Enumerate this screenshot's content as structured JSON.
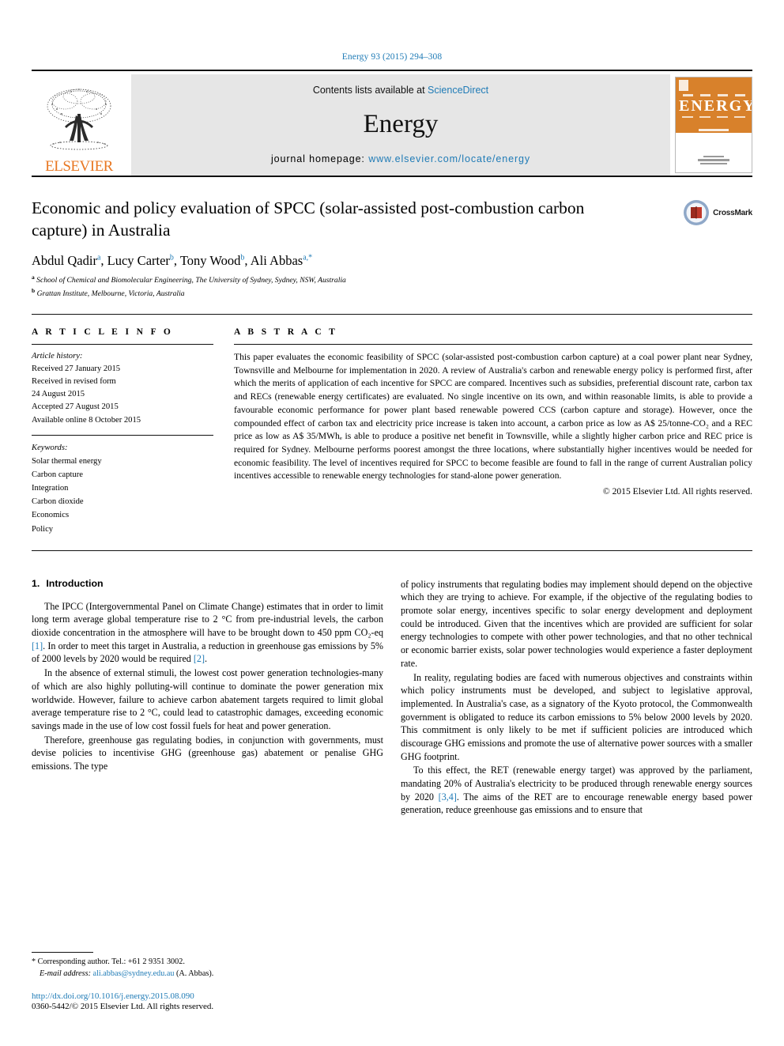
{
  "journal_ref": "Energy 93 (2015) 294–308",
  "masthead": {
    "publisher": "ELSEVIER",
    "contents_line_prefix": "Contents lists available at ",
    "sciencedirect": "ScienceDirect",
    "journal_name": "Energy",
    "homepage_label": "journal homepage: ",
    "homepage_url": "www.elsevier.com/locate/energy",
    "cover_title": "ENERGY",
    "accent_orange": "#E87722",
    "accent_blue": "#1f7bb6",
    "banner_bg": "#e6e6e6"
  },
  "article": {
    "title": "Economic and policy evaluation of SPCC (solar-assisted post-combustion carbon capture) in Australia",
    "authors_html": "Abdul Qadir a, Lucy Carter b, Tony Wood b, Ali Abbas a,*",
    "authors": [
      {
        "name": "Abdul Qadir",
        "marks": "a"
      },
      {
        "name": "Lucy Carter",
        "marks": "b"
      },
      {
        "name": "Tony Wood",
        "marks": "b"
      },
      {
        "name": "Ali Abbas",
        "marks": "a,*"
      }
    ],
    "affiliations": [
      {
        "mark": "a",
        "text": "School of Chemical and Biomolecular Engineering, The University of Sydney, Sydney, NSW, Australia"
      },
      {
        "mark": "b",
        "text": "Grattan Institute, Melbourne, Victoria, Australia"
      }
    ],
    "crossmark_label": "CrossMark"
  },
  "article_info": {
    "heading": "A R T I C L E    I N F O",
    "history_label": "Article history:",
    "history": [
      "Received 27 January 2015",
      "Received in revised form",
      "24 August 2015",
      "Accepted 27 August 2015",
      "Available online 8 October 2015"
    ],
    "keywords_label": "Keywords:",
    "keywords": [
      "Solar thermal energy",
      "Carbon capture",
      "Integration",
      "Carbon dioxide",
      "Economics",
      "Policy"
    ]
  },
  "abstract": {
    "heading": "A B S T R A C T",
    "text": "This paper evaluates the economic feasibility of SPCC (solar-assisted post-combustion carbon capture) at a coal power plant near Sydney, Townsville and Melbourne for implementation in 2020. A review of Australia's carbon and renewable energy policy is performed first, after which the merits of application of each incentive for SPCC are compared. Incentives such as subsidies, preferential discount rate, carbon tax and RECs (renewable energy certificates) are evaluated. No single incentive on its own, and within reasonable limits, is able to provide a favourable economic performance for power plant based renewable powered CCS (carbon capture and storage). However, once the compounded effect of carbon tax and electricity price increase is taken into account, a carbon price as low as A$ 25/tonne-CO₂ and a REC price as low as A$ 35/MWhₑ is able to produce a positive net benefit in Townsville, while a slightly higher carbon price and REC price is required for Sydney. Melbourne performs poorest amongst the three locations, where substantially higher incentives would be needed for economic feasibility. The level of incentives required for SPCC to become feasible are found to fall in the range of current Australian policy incentives accessible to renewable energy technologies for stand-alone power generation.",
    "copyright": "© 2015 Elsevier Ltd. All rights reserved."
  },
  "body": {
    "section_number": "1.",
    "section_title": "Introduction",
    "left_paragraphs": [
      "The IPCC (Intergovernmental Panel on Climate Change) estimates that in order to limit long term average global temperature rise to 2 °C from pre-industrial levels, the carbon dioxide concentration in the atmosphere will have to be brought down to 450 ppm CO₂-eq [1]. In order to meet this target in Australia, a reduction in greenhouse gas emissions by 5% of 2000 levels by 2020 would be required [2].",
      "In the absence of external stimuli, the lowest cost power generation technologies-many of which are also highly polluting-will continue to dominate the power generation mix worldwide. However, failure to achieve carbon abatement targets required to limit global average temperature rise to 2 °C, could lead to catastrophic damages, exceeding economic savings made in the use of low cost fossil fuels for heat and power generation.",
      "Therefore, greenhouse gas regulating bodies, in conjunction with governments, must devise policies to incentivise GHG (greenhouse gas) abatement or penalise GHG emissions. The type"
    ],
    "right_paragraphs": [
      "of policy instruments that regulating bodies may implement should depend on the objective which they are trying to achieve. For example, if the objective of the regulating bodies to promote solar energy, incentives specific to solar energy development and deployment could be introduced. Given that the incentives which are provided are sufficient for solar energy technologies to compete with other power technologies, and that no other technical or economic barrier exists, solar power technologies would experience a faster deployment rate.",
      "In reality, regulating bodies are faced with numerous objectives and constraints within which policy instruments must be developed, and subject to legislative approval, implemented. In Australia's case, as a signatory of the Kyoto protocol, the Commonwealth government is obligated to reduce its carbon emissions to 5% below 2000 levels by 2020. This commitment is only likely to be met if sufficient policies are introduced which discourage GHG emissions and promote the use of alternative power sources with a smaller GHG footprint.",
      "To this effect, the RET (renewable energy target) was approved by the parliament, mandating 20% of Australia's electricity to be produced through renewable energy sources by 2020 [3,4]. The aims of the RET are to encourage renewable energy based power generation, reduce greenhouse gas emissions and to ensure that"
    ],
    "citations": [
      "[1]",
      "[2]",
      "[3,4]"
    ]
  },
  "footnote": {
    "corresponding": "* Corresponding author. Tel.: +61 2 9351 3002.",
    "email_label": "E-mail address: ",
    "email": "ali.abbas@sydney.edu.au",
    "email_suffix": " (A. Abbas).",
    "doi": "http://dx.doi.org/10.1016/j.energy.2015.08.090",
    "issn": "0360-5442/© 2015 Elsevier Ltd. All rights reserved."
  }
}
